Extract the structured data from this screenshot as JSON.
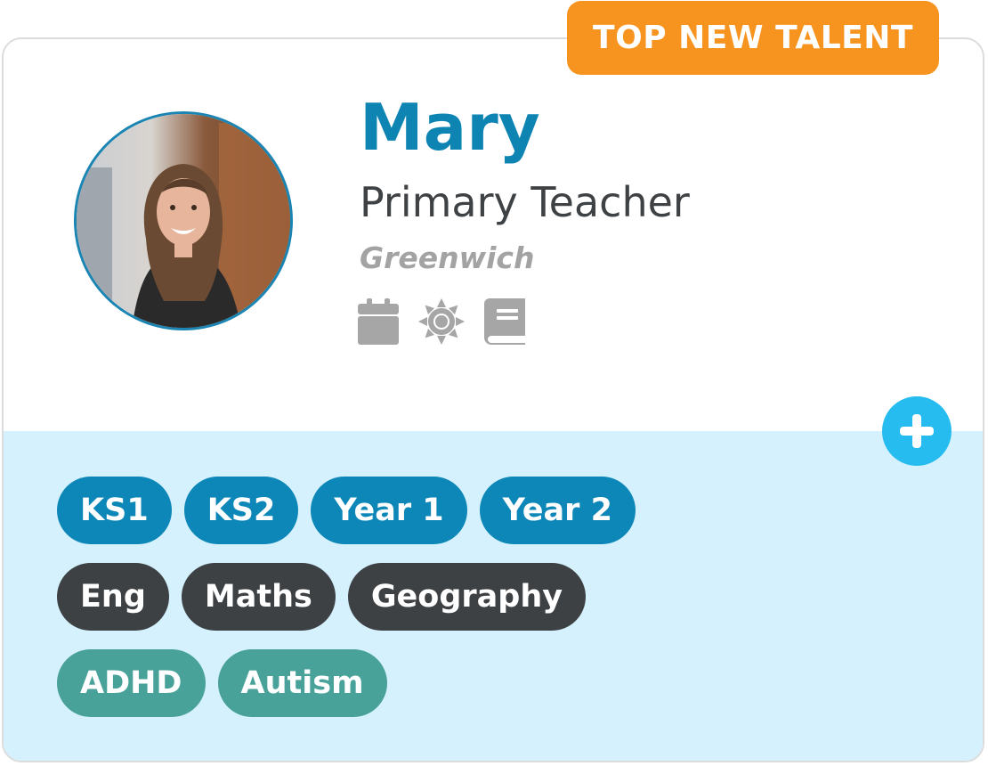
{
  "badge": {
    "label": "TOP NEW TALENT",
    "color": "#f7941f"
  },
  "profile": {
    "name": "Mary",
    "role": "Primary Teacher",
    "location": "Greenwich",
    "avatar": "profile-photo"
  },
  "status_icons": [
    "calendar-icon",
    "sun-icon",
    "book-icon"
  ],
  "add_button": {
    "icon": "plus-icon",
    "color": "#26bcf0"
  },
  "tags": {
    "stages": [
      "KS1",
      "KS2",
      "Year 1",
      "Year 2"
    ],
    "subjects": [
      "Eng",
      "Maths",
      "Geography"
    ],
    "needs": [
      "ADHD",
      "Autism"
    ]
  },
  "colors": {
    "name": "#0e84b3",
    "stage_tag": "#0c87b8",
    "subject_tag": "#3e4144",
    "needs_tag": "#48a29a",
    "panel": "#d4f1fd"
  }
}
